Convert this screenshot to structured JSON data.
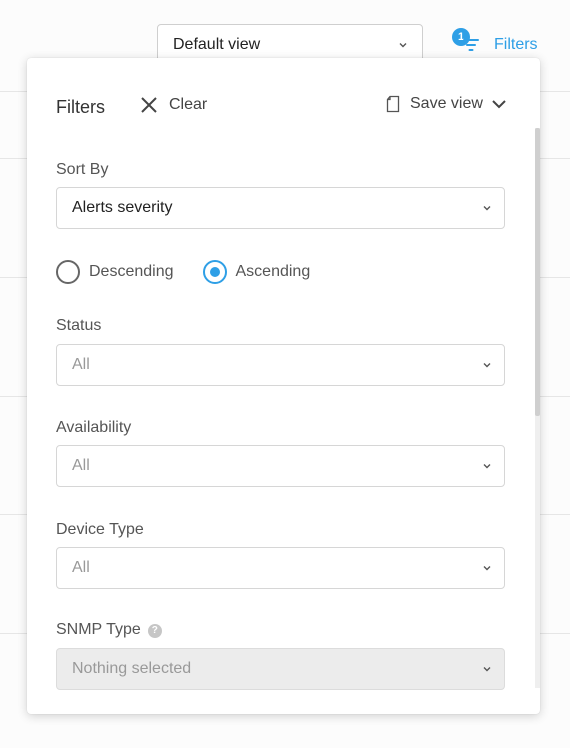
{
  "topbar": {
    "view_select_value": "Default view",
    "filters_label": "Filters",
    "filters_count": "1"
  },
  "panel": {
    "title": "Filters",
    "clear_label": "Clear",
    "save_view_label": "Save view",
    "sort_by": {
      "label": "Sort By",
      "value": "Alerts severity",
      "order_options": [
        "Descending",
        "Ascending"
      ],
      "selected_order": "Ascending"
    },
    "fields": [
      {
        "label": "Status",
        "value": "All",
        "state": "empty"
      },
      {
        "label": "Availability",
        "value": "All",
        "state": "empty"
      },
      {
        "label": "Device Type",
        "value": "All",
        "state": "empty"
      },
      {
        "label": "SNMP Type",
        "value": "Nothing selected",
        "state": "disabled",
        "help_icon": "help-icon"
      }
    ]
  },
  "colors": {
    "accent": "#2e9fe6",
    "disabled_bg": "#ececec"
  }
}
